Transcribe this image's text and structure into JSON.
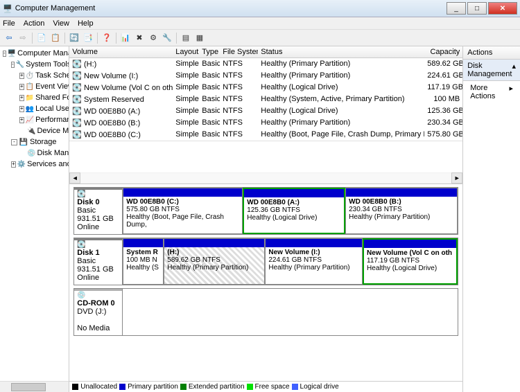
{
  "titlebar": {
    "title": "Computer Management"
  },
  "menu": {
    "file": "File",
    "action": "Action",
    "view": "View",
    "help": "Help"
  },
  "tree": {
    "root": "Computer Management",
    "systools": "System Tools",
    "tasksched": "Task Scheduler",
    "eventviewer": "Event Viewer",
    "sharedfolders": "Shared Folders",
    "localusers": "Local Users and Gro",
    "performance": "Performance",
    "devicemgr": "Device Manager",
    "storage": "Storage",
    "diskmgmt": "Disk Management",
    "services": "Services and Applicati"
  },
  "cols": {
    "volume": "Volume",
    "layout": "Layout",
    "type": "Type",
    "fs": "File System",
    "status": "Status",
    "capacity": "Capacity"
  },
  "vols": [
    {
      "v": " (H:)",
      "l": "Simple",
      "t": "Basic",
      "f": "NTFS",
      "s": "Healthy (Primary Partition)",
      "c": "589.62 GB"
    },
    {
      "v": "New Volume (I:)",
      "l": "Simple",
      "t": "Basic",
      "f": "NTFS",
      "s": "Healthy (Primary Partition)",
      "c": "224.61 GB"
    },
    {
      "v": "New Volume (Vol C on other) (G:)",
      "l": "Simple",
      "t": "Basic",
      "f": "NTFS",
      "s": "Healthy (Logical Drive)",
      "c": "117.19 GB"
    },
    {
      "v": "System Reserved",
      "l": "Simple",
      "t": "Basic",
      "f": "NTFS",
      "s": "Healthy (System, Active, Primary Partition)",
      "c": "100 MB"
    },
    {
      "v": "WD 00E8B0 (A:)",
      "l": "Simple",
      "t": "Basic",
      "f": "NTFS",
      "s": "Healthy (Logical Drive)",
      "c": "125.36 GB"
    },
    {
      "v": "WD 00E8B0 (B:)",
      "l": "Simple",
      "t": "Basic",
      "f": "NTFS",
      "s": "Healthy (Primary Partition)",
      "c": "230.34 GB"
    },
    {
      "v": "WD 00E8B0 (C:)",
      "l": "Simple",
      "t": "Basic",
      "f": "NTFS",
      "s": "Healthy (Boot, Page File, Crash Dump, Primary Partition)",
      "c": "575.80 GB"
    }
  ],
  "disk0": {
    "name": "Disk 0",
    "cls": "Basic",
    "size": "931.51 GB",
    "state": "Online",
    "p0": {
      "name": "WD 00E8B0  (C:)",
      "size": "575.80 GB NTFS",
      "status": "Healthy (Boot, Page File, Crash Dump,"
    },
    "p1": {
      "name": "WD 00E8B0  (A:)",
      "size": "125.36 GB NTFS",
      "status": "Healthy (Logical Drive)"
    },
    "p2": {
      "name": "WD 00E8B0  (B:)",
      "size": "230.34 GB NTFS",
      "status": "Healthy (Primary Partition)"
    }
  },
  "disk1": {
    "name": "Disk 1",
    "cls": "Basic",
    "size": "931.51 GB",
    "state": "Online",
    "p0": {
      "name": "System R",
      "size": "100 MB N",
      "status": "Healthy (S"
    },
    "p1": {
      "name": " (H:)",
      "size": "589.62 GB NTFS",
      "status": "Healthy (Primary Partition)"
    },
    "p2": {
      "name": "New Volume  (I:)",
      "size": "224.61 GB NTFS",
      "status": "Healthy (Primary Partition)"
    },
    "p3": {
      "name": "New Volume (Vol C on oth",
      "size": "117.19 GB NTFS",
      "status": "Healthy (Logical Drive)"
    }
  },
  "cdrom": {
    "name": "CD-ROM 0",
    "cls": "DVD (J:)",
    "media": "No Media"
  },
  "legend": {
    "unalloc": "Unallocated",
    "primary": "Primary partition",
    "extended": "Extended partition",
    "free": "Free space",
    "logical": "Logical drive"
  },
  "actions": {
    "hdr": "Actions",
    "section": "Disk Management",
    "more": "More Actions"
  }
}
